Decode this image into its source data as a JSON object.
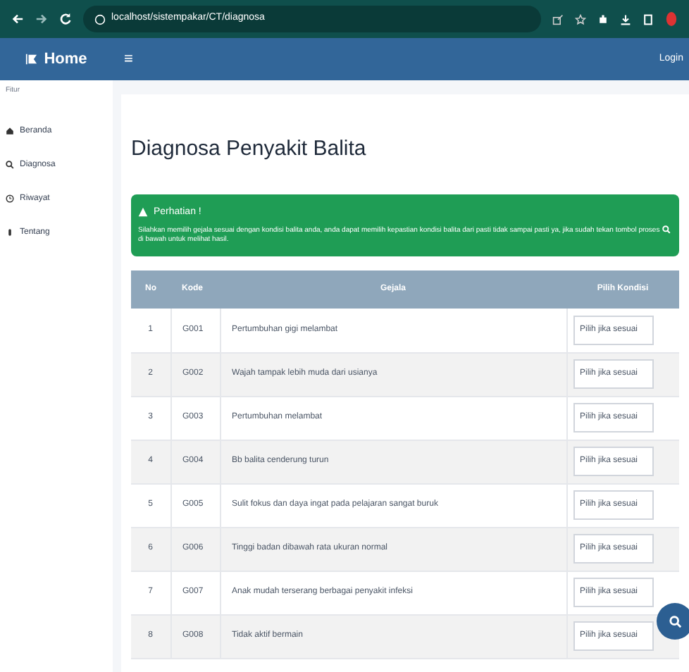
{
  "browser": {
    "address": "localhost/sistempakar/CT/diagnosa"
  },
  "navbar": {
    "brand": "Home",
    "menu_glyph": "≡",
    "login": "Login"
  },
  "sidebar": {
    "heading": "Fitur",
    "items": [
      {
        "label": "Beranda"
      },
      {
        "label": "Diagnosa"
      },
      {
        "label": "Riwayat"
      },
      {
        "label": "Tentang"
      }
    ]
  },
  "page_title": "Diagnosa Penyakit Balita",
  "alert": {
    "title": "Perhatian !",
    "text_before": "Silahkan memilih gejala sesuai dengan kondisi balita anda, anda dapat memilih kepastian kondisi balita dari pasti tidak sampai pasti ya, jika sudah tekan tombol proses",
    "text_after": "di bawah untuk melihat hasil."
  },
  "table": {
    "columns": [
      "No",
      "Kode",
      "Gejala",
      "Pilih Kondisi"
    ],
    "rows": [
      {
        "no": "1",
        "kode": "G001",
        "gejala": "Pertumbuhan gigi melambat",
        "kondisi": "Pilih jika sesuai"
      },
      {
        "no": "2",
        "kode": "G002",
        "gejala": "Wajah tampak lebih muda dari usianya",
        "kondisi": "Pilih jika sesuai"
      },
      {
        "no": "3",
        "kode": "G003",
        "gejala": "Pertumbuhan melambat",
        "kondisi": "Pilih jika sesuai"
      },
      {
        "no": "4",
        "kode": "G004",
        "gejala": "Bb balita cenderung turun",
        "kondisi": "Pilih jika sesuai"
      },
      {
        "no": "5",
        "kode": "G005",
        "gejala": "Sulit fokus dan daya ingat pada pelajaran sangat buruk",
        "kondisi": "Pilih jika sesuai"
      },
      {
        "no": "6",
        "kode": "G006",
        "gejala": "Tinggi badan dibawah rata ukuran normal",
        "kondisi": "Pilih jika sesuai"
      },
      {
        "no": "7",
        "kode": "G007",
        "gejala": "Anak mudah terserang berbagai penyakit infeksi",
        "kondisi": "Pilih jika sesuai"
      },
      {
        "no": "8",
        "kode": "G008",
        "gejala": "Tidak aktif bermain",
        "kondisi": "Pilih jika sesuai"
      }
    ]
  }
}
